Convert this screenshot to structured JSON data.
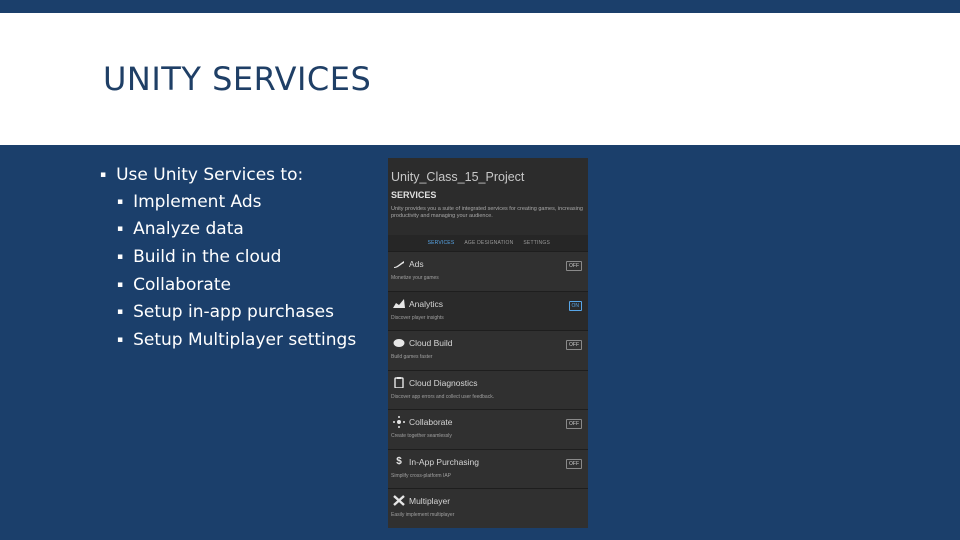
{
  "slide": {
    "title": "UNITY SERVICES",
    "colors": {
      "band": "#1b3f6b",
      "title_bg": "#ffffff",
      "title_text": "#1f3f66"
    }
  },
  "bullets": {
    "main": "Use Unity Services to:",
    "items": [
      "Implement Ads",
      "Analyze data",
      "Build in the cloud",
      "Collaborate",
      "Setup in-app purchases",
      "Setup Multiplayer settings"
    ]
  },
  "panel": {
    "project_name": "Unity_Class_15_Project",
    "heading": "SERVICES",
    "description": "Unity provides you a suite of integrated services for creating games, increasing productivity and managing your audience.",
    "tabs": [
      "SERVICES",
      "AGE DESIGNATION",
      "SETTINGS"
    ],
    "services": [
      {
        "name": "Ads",
        "desc": "Monetize your games",
        "toggle": "OFF",
        "icon": "ads-icon"
      },
      {
        "name": "Analytics",
        "desc": "Discover player insights",
        "toggle": "ON",
        "icon": "analytics-icon"
      },
      {
        "name": "Cloud Build",
        "desc": "Build games faster",
        "toggle": "OFF",
        "icon": "cloud-build-icon"
      },
      {
        "name": "Cloud Diagnostics",
        "desc": "Discover app errors and collect user feedback.",
        "toggle": "",
        "icon": "clipboard-icon"
      },
      {
        "name": "Collaborate",
        "desc": "Create together seamlessly",
        "toggle": "OFF",
        "icon": "collaborate-icon"
      },
      {
        "name": "In-App Purchasing",
        "desc": "Simplify cross-platform IAP",
        "toggle": "OFF",
        "icon": "dollar-icon"
      },
      {
        "name": "Multiplayer",
        "desc": "Easily implement multiplayer",
        "toggle": "",
        "icon": "multiplayer-icon"
      }
    ]
  }
}
